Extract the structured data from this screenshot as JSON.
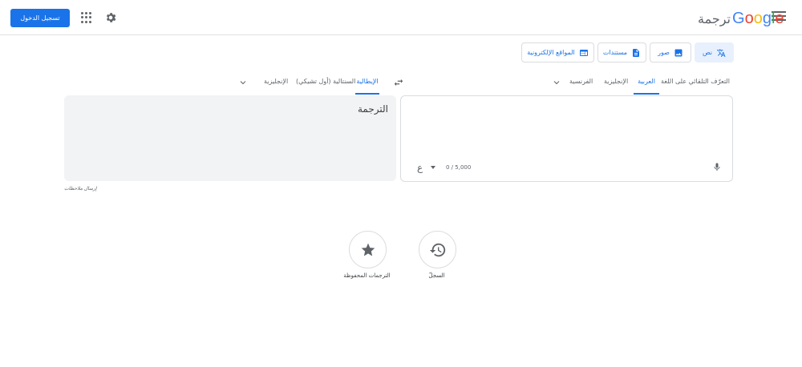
{
  "header": {
    "logo_word": "Google",
    "logo_suffix": "ترجمة",
    "signin_label": "تسجيل الدخول"
  },
  "modes": [
    {
      "label": "نص",
      "icon": "translate-icon",
      "active": true
    },
    {
      "label": "صور",
      "icon": "image-icon",
      "active": false
    },
    {
      "label": "مستندات",
      "icon": "document-icon",
      "active": false
    },
    {
      "label": "المواقع الإلكترونية",
      "icon": "web-icon",
      "active": false
    }
  ],
  "source_langs": [
    "التعرّف التلقائي على اللغة",
    "العربية",
    "الإنجليزية",
    "الفرنسية"
  ],
  "source_selected": "العربية",
  "target_langs": [
    "الإيطالية",
    "السنتالية (أول تشيكي)",
    "الإنجليزية"
  ],
  "target_selected": "الإيطالية",
  "source": {
    "char_count": "0 / 5,000",
    "keyboard_glyph": "ع"
  },
  "target": {
    "placeholder": "الترجمة"
  },
  "feedback_label": "إرسال ملاحظات",
  "history_label": "السجلّ",
  "saved_label": "الترجمات المحفوظة",
  "colors": {
    "accent": "#1a73e8",
    "panel_bg": "#f1f3f4"
  }
}
